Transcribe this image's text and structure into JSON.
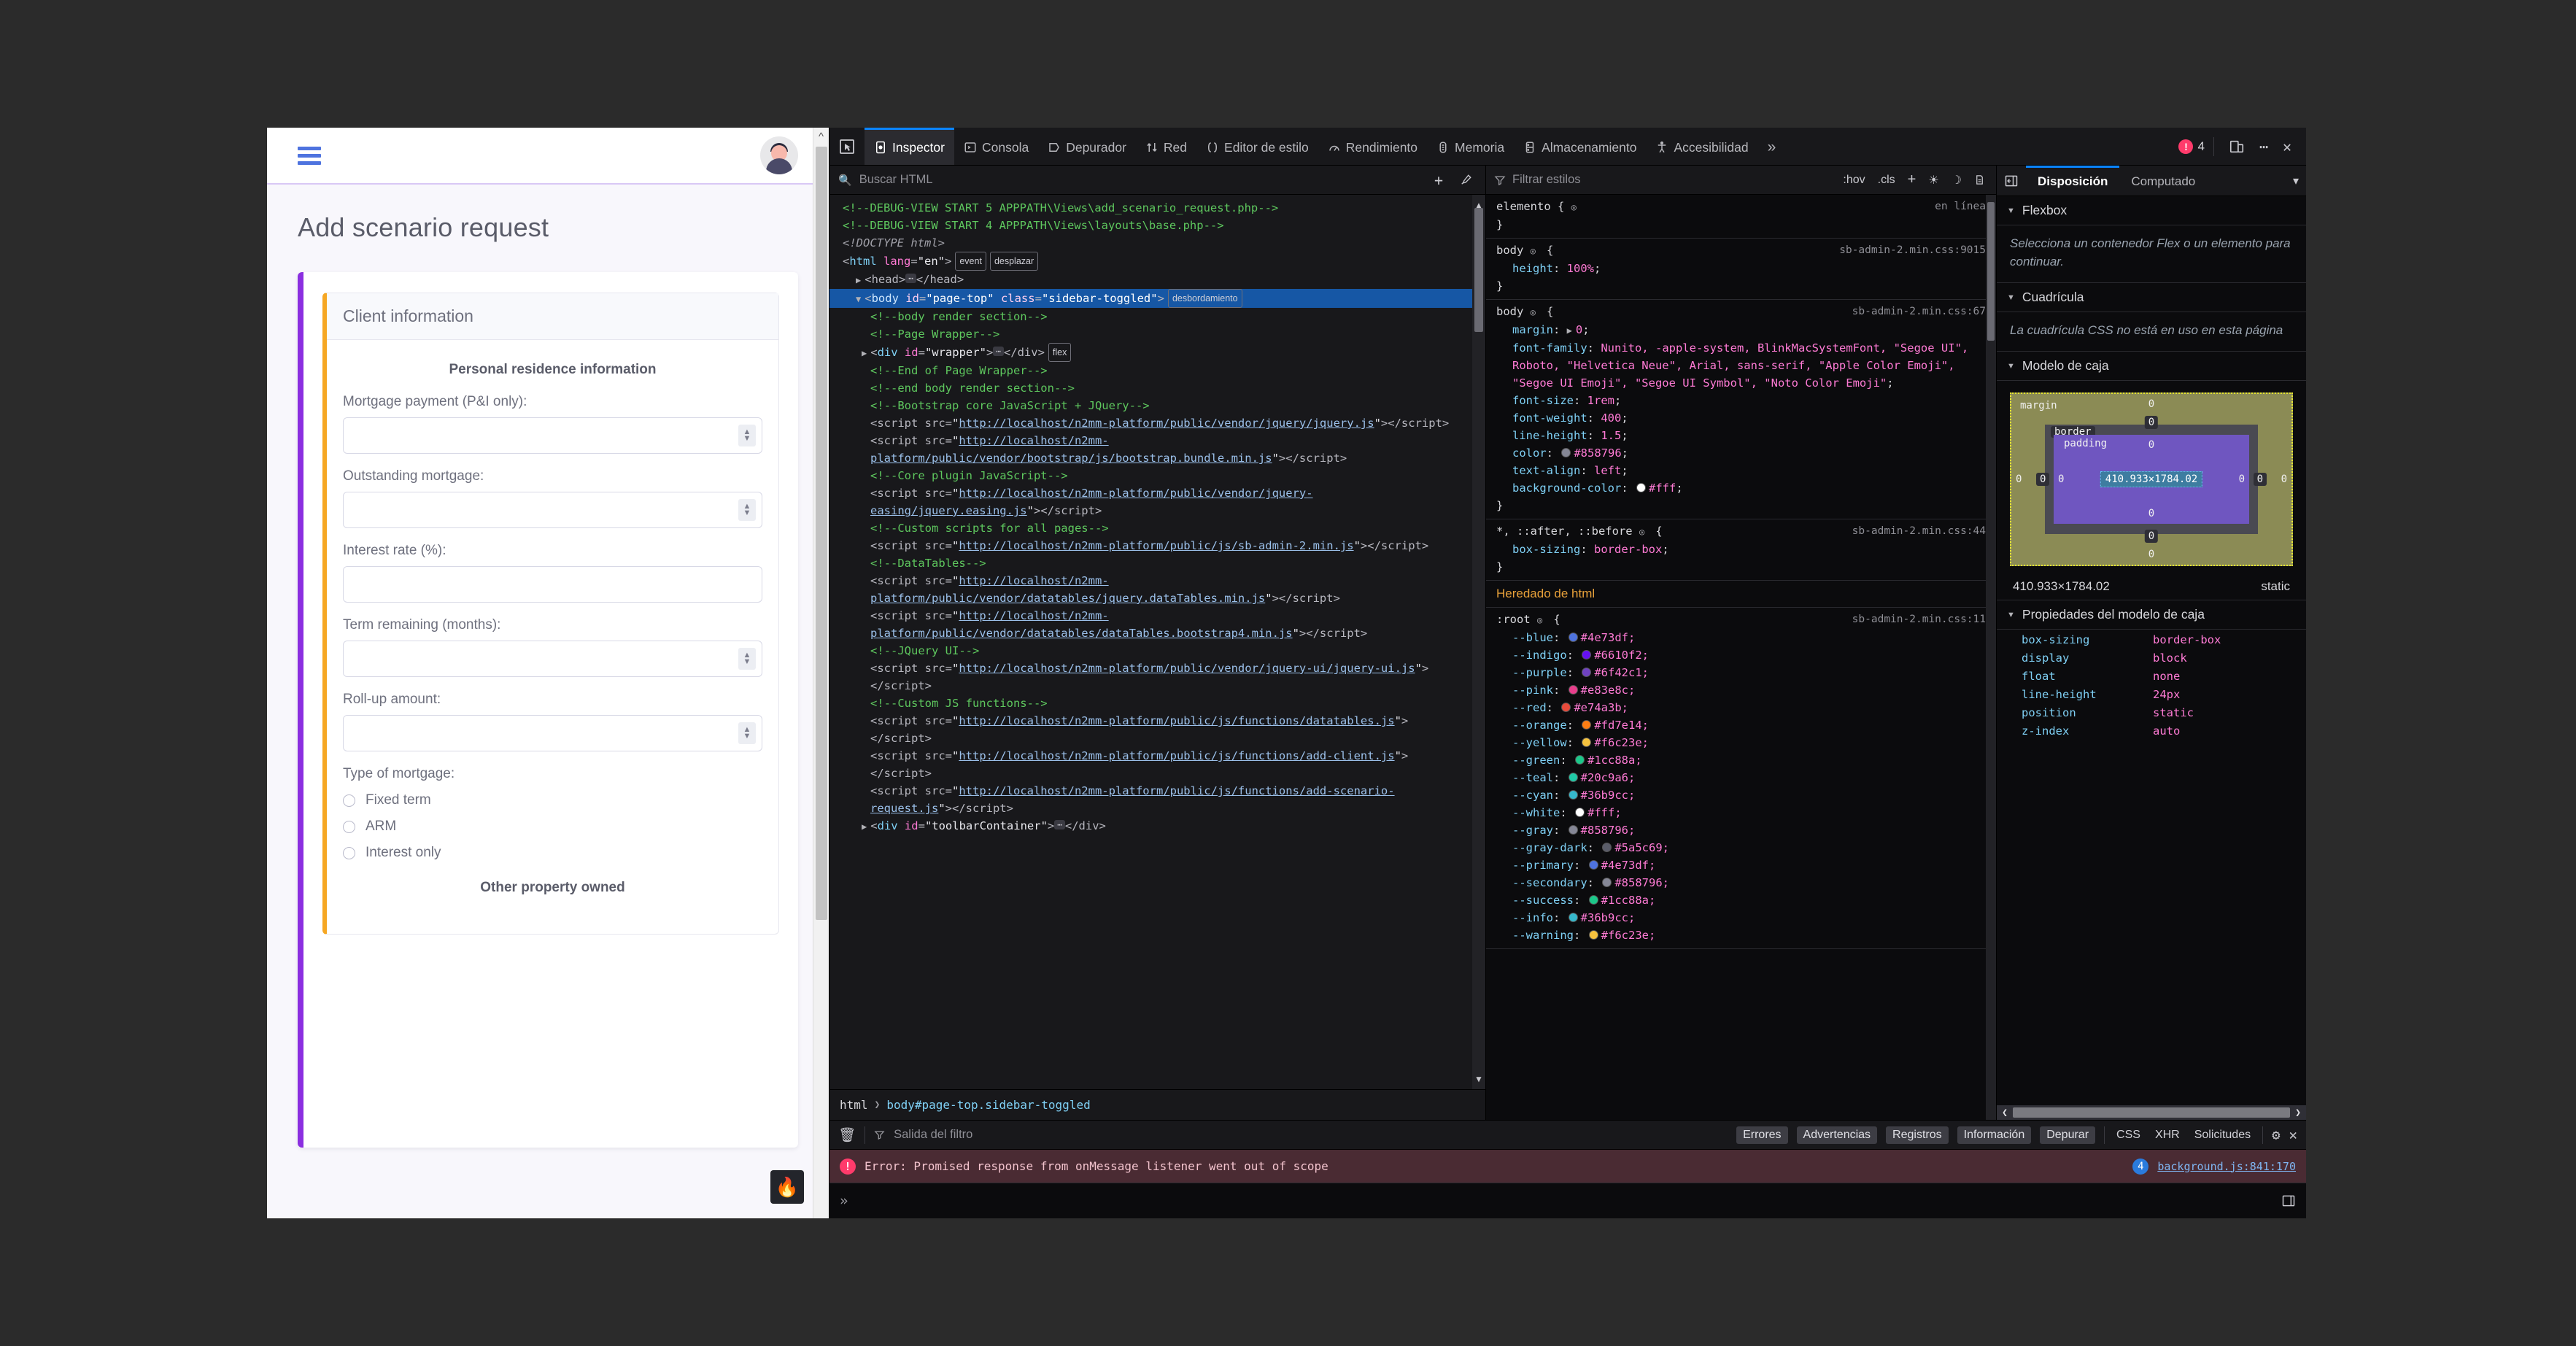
{
  "webpage": {
    "topbar": {
      "menu_icon": "hamburger-icon",
      "avatar_icon": "user-avatar"
    },
    "title": "Add scenario request",
    "card": {
      "header": "Client information",
      "section_title": "Personal residence information",
      "fields": [
        {
          "label": "Mortgage payment (P&I only):",
          "value": "",
          "spinner": true
        },
        {
          "label": "Outstanding mortgage:",
          "value": "",
          "spinner": true
        },
        {
          "label": "Interest rate (%):",
          "value": "",
          "spinner": false
        },
        {
          "label": "Term remaining (months):",
          "value": "",
          "spinner": true
        },
        {
          "label": "Roll-up amount:",
          "value": "",
          "spinner": true
        }
      ],
      "radio_group_label": "Type of mortgage:",
      "radios": [
        "Fixed term",
        "ARM",
        "Interest only"
      ],
      "next_section_title": "Other property owned"
    },
    "fire_badge": "🔥"
  },
  "devtools": {
    "tabs": [
      {
        "label": "Inspector",
        "icon": "inspector-icon",
        "active": true
      },
      {
        "label": "Consola",
        "icon": "console-icon",
        "active": false
      },
      {
        "label": "Depurador",
        "icon": "debugger-icon",
        "active": false
      },
      {
        "label": "Red",
        "icon": "network-icon",
        "active": false
      },
      {
        "label": "Editor de estilo",
        "icon": "style-editor-icon",
        "active": false
      },
      {
        "label": "Rendimiento",
        "icon": "performance-icon",
        "active": false
      },
      {
        "label": "Memoria",
        "icon": "memory-icon",
        "active": false
      },
      {
        "label": "Almacenamiento",
        "icon": "storage-icon",
        "active": false
      },
      {
        "label": "Accesibilidad",
        "icon": "accessibility-icon",
        "active": false
      }
    ],
    "overflow_label": "»",
    "error_count": "4",
    "picker_icon": "element-picker-icon",
    "responsive_icon": "responsive-design-mode-icon",
    "meatball_icon": "more-options-icon",
    "close_icon": "close-icon",
    "html_pane": {
      "search_placeholder": "Buscar HTML",
      "add_node_icon": "plus-icon",
      "eyedropper_icon": "eyedropper-icon",
      "lines": [
        {
          "indent": 0,
          "type": "comment",
          "text": "<!--DEBUG-VIEW START 5 APPPATH\\Views\\add_scenario_request.php-->"
        },
        {
          "indent": 0,
          "type": "comment",
          "text": "<!--DEBUG-VIEW START 4 APPPATH\\Views\\layouts\\base.php-->"
        },
        {
          "indent": 0,
          "type": "doctype",
          "text": "<!DOCTYPE html>"
        },
        {
          "indent": 0,
          "type": "tag_html",
          "text": "<html lang=\"en\">",
          "badges": [
            "event",
            "desplazar"
          ]
        },
        {
          "indent": 1,
          "type": "collapsed",
          "text": "<head>…</head>",
          "twisty": true
        },
        {
          "indent": 1,
          "type": "selected",
          "text": "<body id=\"page-top\" class=\"sidebar-toggled\">",
          "badges": [
            "desbordamiento"
          ],
          "twisty": true
        },
        {
          "indent": 2,
          "type": "comment",
          "text": "<!--body render section-->"
        },
        {
          "indent": 2,
          "type": "comment",
          "text": "<!--Page Wrapper-->"
        },
        {
          "indent": 2,
          "type": "node",
          "text": "<div id=\"wrapper\">…</div>",
          "badges": [
            "flex"
          ],
          "twisty": true
        },
        {
          "indent": 2,
          "type": "comment",
          "text": "<!--End of Page Wrapper-->"
        },
        {
          "indent": 2,
          "type": "comment",
          "text": "<!--end body render section-->"
        },
        {
          "indent": 2,
          "type": "comment",
          "text": "<!--Bootstrap core JavaScript + JQuery-->"
        },
        {
          "indent": 2,
          "type": "script",
          "url": "http://localhost/n2mm-platform/public/vendor/jquery/jquery.js"
        },
        {
          "indent": 2,
          "type": "script",
          "url": "http://localhost/n2mm-platform/public/vendor/bootstrap/js/bootstrap.bundle.min.js"
        },
        {
          "indent": 2,
          "type": "comment",
          "text": "<!--Core plugin JavaScript-->"
        },
        {
          "indent": 2,
          "type": "script",
          "url": "http://localhost/n2mm-platform/public/vendor/jquery-easing/jquery.easing.js"
        },
        {
          "indent": 2,
          "type": "comment",
          "text": "<!--Custom scripts for all pages-->"
        },
        {
          "indent": 2,
          "type": "script",
          "url": "http://localhost/n2mm-platform/public/js/sb-admin-2.min.js"
        },
        {
          "indent": 2,
          "type": "comment",
          "text": "<!--DataTables-->"
        },
        {
          "indent": 2,
          "type": "script",
          "url": "http://localhost/n2mm-platform/public/vendor/datatables/jquery.dataTables.min.js"
        },
        {
          "indent": 2,
          "type": "script",
          "url": "http://localhost/n2mm-platform/public/vendor/datatables/dataTables.bootstrap4.min.js"
        },
        {
          "indent": 2,
          "type": "comment",
          "text": "<!--JQuery UI-->"
        },
        {
          "indent": 2,
          "type": "script",
          "url": "http://localhost/n2mm-platform/public/vendor/jquery-ui/jquery-ui.js"
        },
        {
          "indent": 2,
          "type": "comment",
          "text": "<!--Custom JS functions-->"
        },
        {
          "indent": 2,
          "type": "script",
          "url": "http://localhost/n2mm-platform/public/js/functions/datatables.js"
        },
        {
          "indent": 2,
          "type": "script",
          "url": "http://localhost/n2mm-platform/public/js/functions/add-client.js"
        },
        {
          "indent": 2,
          "type": "script",
          "url": "http://localhost/n2mm-platform/public/js/functions/add-scenario-request.js"
        },
        {
          "indent": 2,
          "type": "node",
          "text": "<div id=\"toolbarContainer\">…</div>",
          "twisty": true
        }
      ],
      "breadcrumb": [
        "html",
        "body#page-top.sidebar-toggled"
      ]
    },
    "css_pane": {
      "filter_placeholder": "Filtrar estilos",
      "hov_label": ":hov",
      "cls_label": ".cls",
      "add_rule_icon": "plus-icon",
      "light_scheme_icon": "sun-icon",
      "dark_scheme_icon": "moon-icon",
      "print_icon": "print-preview-icon",
      "rules": [
        {
          "selector": "elemento {",
          "source": "en línea",
          "declarations": []
        },
        {
          "selector": "body",
          "source": "sb-admin-2.min.css:9015",
          "declarations": [
            {
              "prop": "height",
              "value": "100%"
            }
          ]
        },
        {
          "selector": "body",
          "source": "sb-admin-2.min.css:67",
          "declarations": [
            {
              "prop": "margin",
              "value": "0",
              "expandable": true
            },
            {
              "prop": "font-family",
              "value": "Nunito, -apple-system, BlinkMacSystemFont, \"Segoe UI\", Roboto, \"Helvetica Neue\", Arial, sans-serif, \"Apple Color Emoji\", \"Segoe UI Emoji\", \"Segoe UI Symbol\", \"Noto Color Emoji\""
            },
            {
              "prop": "font-size",
              "value": "1rem"
            },
            {
              "prop": "font-weight",
              "value": "400"
            },
            {
              "prop": "line-height",
              "value": "1.5"
            },
            {
              "prop": "color",
              "value": "#858796",
              "swatch": "#858796"
            },
            {
              "prop": "text-align",
              "value": "left"
            },
            {
              "prop": "background-color",
              "value": "#fff",
              "swatch": "#ffffff"
            }
          ]
        },
        {
          "selector": "*, ::after, ::before",
          "source": "sb-admin-2.min.css:44",
          "declarations": [
            {
              "prop": "box-sizing",
              "value": "border-box"
            }
          ]
        }
      ],
      "inherited_header": "Heredado de html",
      "root_rule": {
        "selector": ":root",
        "source": "sb-admin-2.min.css:11",
        "declarations": [
          {
            "prop": "--blue",
            "value": "#4e73df",
            "swatch": "#4e73df"
          },
          {
            "prop": "--indigo",
            "value": "#6610f2",
            "swatch": "#6610f2"
          },
          {
            "prop": "--purple",
            "value": "#6f42c1",
            "swatch": "#6f42c1"
          },
          {
            "prop": "--pink",
            "value": "#e83e8c",
            "swatch": "#e83e8c"
          },
          {
            "prop": "--red",
            "value": "#e74a3b",
            "swatch": "#e74a3b"
          },
          {
            "prop": "--orange",
            "value": "#fd7e14",
            "swatch": "#fd7e14"
          },
          {
            "prop": "--yellow",
            "value": "#f6c23e",
            "swatch": "#f6c23e"
          },
          {
            "prop": "--green",
            "value": "#1cc88a",
            "swatch": "#1cc88a"
          },
          {
            "prop": "--teal",
            "value": "#20c9a6",
            "swatch": "#20c9a6"
          },
          {
            "prop": "--cyan",
            "value": "#36b9cc",
            "swatch": "#36b9cc"
          },
          {
            "prop": "--white",
            "value": "#fff",
            "swatch": "#ffffff"
          },
          {
            "prop": "--gray",
            "value": "#858796",
            "swatch": "#858796"
          },
          {
            "prop": "--gray-dark",
            "value": "#5a5c69",
            "swatch": "#5a5c69"
          },
          {
            "prop": "--primary",
            "value": "#4e73df",
            "swatch": "#4e73df"
          },
          {
            "prop": "--secondary",
            "value": "#858796",
            "swatch": "#858796"
          },
          {
            "prop": "--success",
            "value": "#1cc88a",
            "swatch": "#1cc88a"
          },
          {
            "prop": "--info",
            "value": "#36b9cc",
            "swatch": "#36b9cc"
          },
          {
            "prop": "--warning",
            "value": "#f6c23e",
            "swatch": "#f6c23e"
          }
        ]
      }
    },
    "layout_pane": {
      "tabs": [
        {
          "label": "Disposición",
          "active": true
        },
        {
          "label": "Computado",
          "active": false
        }
      ],
      "sidebar_toggle_icon": "toggle-sidebar-icon",
      "more_icon": "chevron-down-icon",
      "flexbox_title": "Flexbox",
      "flexbox_note": "Selecciona un contenedor Flex o un elemento para continuar.",
      "grid_title": "Cuadrícula",
      "grid_note": "La cuadrícula CSS no está en uso en esta página",
      "boxmodel_title": "Modelo de caja",
      "boxmodel": {
        "margin_label": "margin",
        "border_label": "border",
        "padding_label": "padding",
        "content_size": "410.933×1784.02",
        "margin_top": "0",
        "margin_right": "0",
        "margin_bottom": "0",
        "margin_left": "0",
        "border_top": "0",
        "border_right": "0",
        "border_bottom": "0",
        "border_left": "0",
        "padding_top": "0",
        "padding_right": "0",
        "padding_bottom": "0",
        "padding_left": "0"
      },
      "dimensions": "410.933×1784.02",
      "position_mode": "static",
      "props_title": "Propiedades del modelo de caja",
      "props": [
        {
          "key": "box-sizing",
          "value": "border-box"
        },
        {
          "key": "display",
          "value": "block"
        },
        {
          "key": "float",
          "value": "none"
        },
        {
          "key": "line-height",
          "value": "24px"
        },
        {
          "key": "position",
          "value": "static"
        },
        {
          "key": "z-index",
          "value": "auto"
        }
      ]
    },
    "console": {
      "clear_icon": "trash-icon",
      "filter_placeholder": "Salida del filtro",
      "chips": [
        "Errores",
        "Advertencias",
        "Registros",
        "Información",
        "Depurar"
      ],
      "plain_filters": [
        "CSS",
        "XHR",
        "Solicitudes"
      ],
      "settings_icon": "gear-icon",
      "close_icon": "close-icon",
      "error": {
        "message": "Error: Promised response from onMessage listener went out of scope",
        "count": "4",
        "source": "background.js:841:170"
      },
      "prompt": "»",
      "split_icon": "split-console-icon"
    }
  }
}
